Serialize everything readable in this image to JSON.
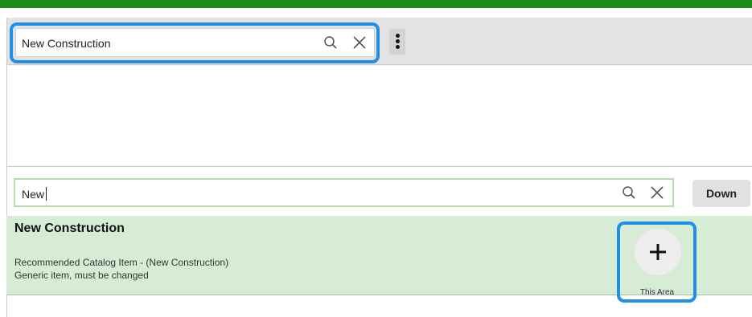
{
  "top_search": {
    "value": "New Construction"
  },
  "filter": {
    "value": "New",
    "down_label": "Down"
  },
  "result": {
    "title": "New Construction",
    "line1": "Recommended Catalog Item - (New Construction)",
    "line2": "Generic item, must be changed",
    "add_label": "This Area"
  },
  "colors": {
    "header_green": "#1a8c1a",
    "row_bg": "#d6ecd5",
    "highlight": "#1e90e8"
  }
}
